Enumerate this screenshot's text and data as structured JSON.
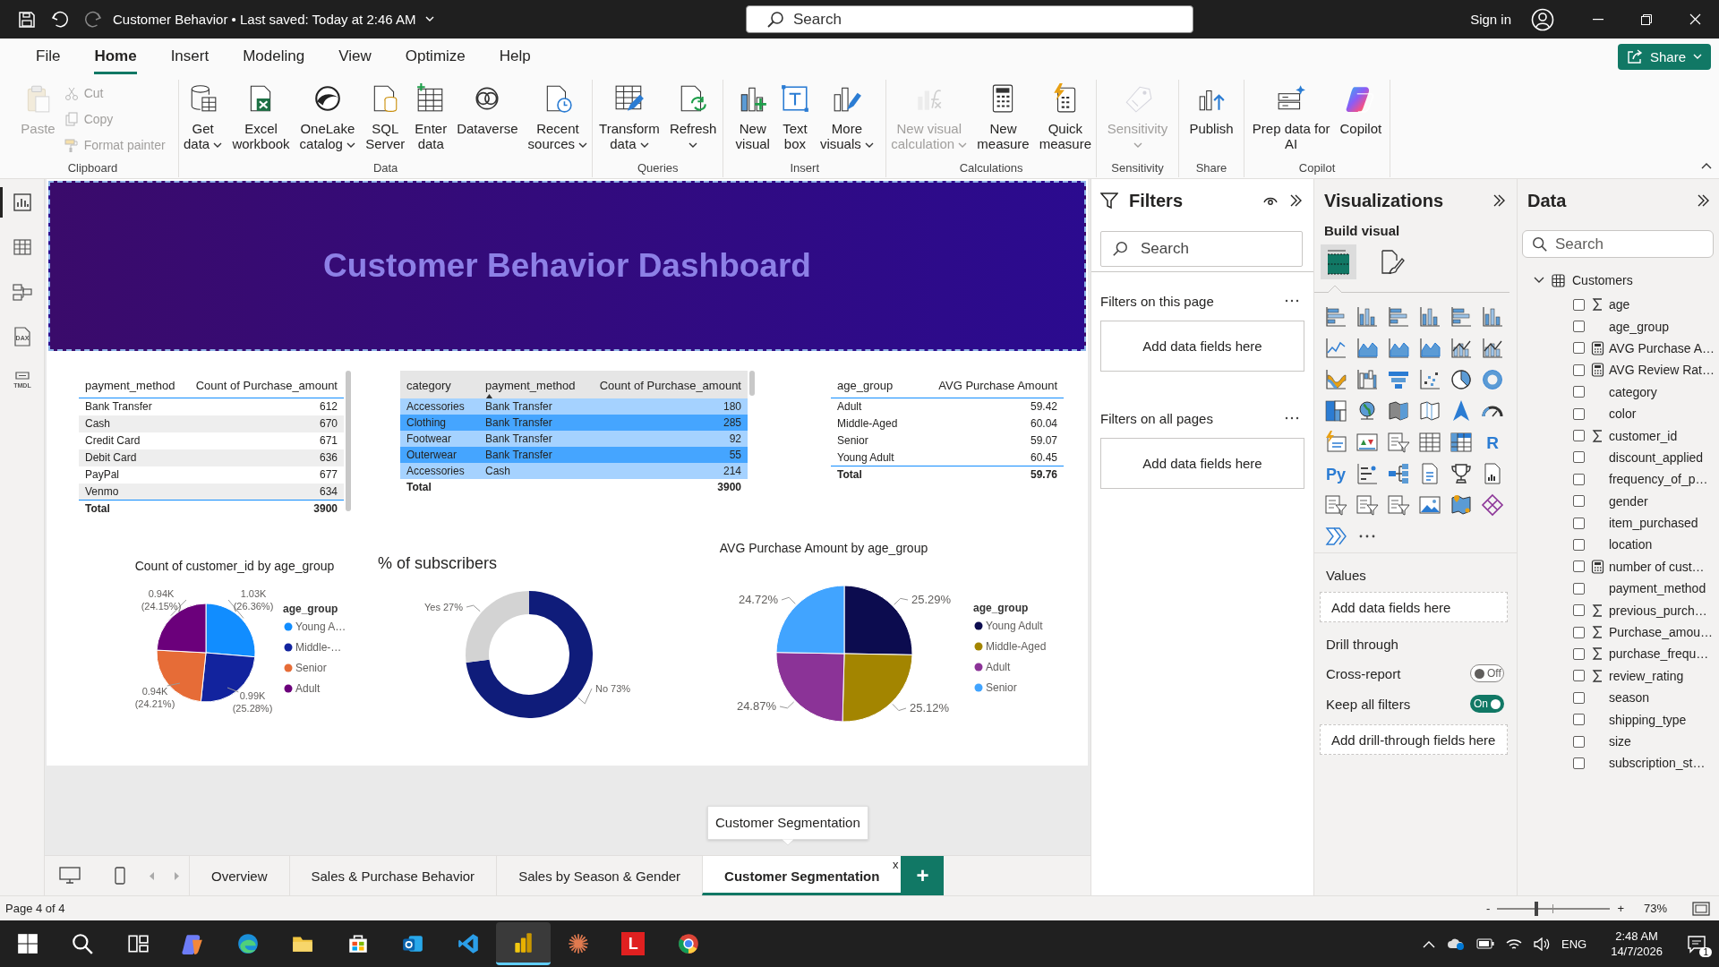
{
  "title_bar": {
    "title": "Customer Behavior • Last saved: Today at 2:46 AM",
    "search_placeholder": "Search",
    "sign_in": "Sign in"
  },
  "menu_tabs": [
    {
      "label": "File",
      "selected": false
    },
    {
      "label": "Home",
      "selected": true
    },
    {
      "label": "Insert",
      "selected": false
    },
    {
      "label": "Modeling",
      "selected": false
    },
    {
      "label": "View",
      "selected": false
    },
    {
      "label": "Optimize",
      "selected": false
    },
    {
      "label": "Help",
      "selected": false
    }
  ],
  "share_button": "Share",
  "ribbon_groups": [
    {
      "label": "Clipboard",
      "buttons": [
        {
          "kind": "large",
          "lines": [
            "Paste"
          ],
          "disabled": true
        },
        {
          "kind": "small",
          "lines": [
            "Cut"
          ],
          "disabled": true
        },
        {
          "kind": "small",
          "lines": [
            "Copy"
          ],
          "disabled": true
        },
        {
          "kind": "small",
          "lines": [
            "Format painter"
          ],
          "disabled": true
        }
      ]
    },
    {
      "label": "Data",
      "buttons": [
        {
          "kind": "large",
          "lines": [
            "Get",
            "data"
          ],
          "dropdown": true,
          "disabled": false
        },
        {
          "kind": "large",
          "lines": [
            "Excel",
            "workbook"
          ],
          "disabled": false
        },
        {
          "kind": "large",
          "lines": [
            "OneLake",
            "catalog"
          ],
          "dropdown": true,
          "disabled": false
        },
        {
          "kind": "large",
          "lines": [
            "SQL",
            "Server"
          ],
          "disabled": false
        },
        {
          "kind": "large",
          "lines": [
            "Enter",
            "data"
          ],
          "disabled": false
        },
        {
          "kind": "large",
          "lines": [
            "Dataverse"
          ],
          "disabled": false
        },
        {
          "kind": "large",
          "lines": [
            "Recent",
            "sources"
          ],
          "dropdown": true,
          "disabled": false
        }
      ]
    },
    {
      "label": "Queries",
      "buttons": [
        {
          "kind": "large",
          "lines": [
            "Transform",
            "data"
          ],
          "dropdown": true,
          "disabled": false
        },
        {
          "kind": "large",
          "lines": [
            "Refresh"
          ],
          "dropdown": true,
          "disabled": false
        }
      ]
    },
    {
      "label": "Insert",
      "buttons": [
        {
          "kind": "large",
          "lines": [
            "New",
            "visual"
          ],
          "disabled": false
        },
        {
          "kind": "large",
          "lines": [
            "Text",
            "box"
          ],
          "disabled": false
        },
        {
          "kind": "large",
          "lines": [
            "More",
            "visuals"
          ],
          "dropdown": true,
          "disabled": false
        }
      ]
    },
    {
      "label": "Calculations",
      "buttons": [
        {
          "kind": "large",
          "lines": [
            "New visual",
            "calculation"
          ],
          "dropdown": true,
          "disabled": true
        },
        {
          "kind": "large",
          "lines": [
            "New",
            "measure"
          ],
          "disabled": false
        },
        {
          "kind": "large",
          "lines": [
            "Quick",
            "measure"
          ],
          "disabled": false
        }
      ]
    },
    {
      "label": "Sensitivity",
      "buttons": [
        {
          "kind": "large",
          "lines": [
            "Sensitivity"
          ],
          "dropdown": true,
          "disabled": true
        }
      ]
    },
    {
      "label": "Share",
      "buttons": [
        {
          "kind": "large",
          "lines": [
            "Publish"
          ],
          "disabled": false
        }
      ]
    },
    {
      "label": "Copilot",
      "buttons": [
        {
          "kind": "large",
          "lines": [
            "Prep data for",
            "AI"
          ],
          "disabled": false
        },
        {
          "kind": "large",
          "lines": [
            "Copilot"
          ],
          "disabled": false
        }
      ]
    }
  ],
  "left_rail": [
    {
      "kind": "report",
      "selected": true
    },
    {
      "kind": "table",
      "selected": false
    },
    {
      "kind": "model",
      "selected": false
    },
    {
      "kind": "dax",
      "label": "DAX",
      "selected": false
    },
    {
      "kind": "tmdl",
      "label": "TMDL",
      "selected": false
    }
  ],
  "report": {
    "banner": {
      "title": "Customer Behavior Dashboard"
    },
    "tables": [
      {
        "kind": "gray-bands",
        "columns": [
          {
            "label": "payment_method",
            "sorted": false
          },
          {
            "label": "Count of Purchase_amount",
            "sorted": false
          }
        ],
        "rows": [
          [
            "Bank Transfer",
            "612"
          ],
          [
            "Cash",
            "670"
          ],
          [
            "Credit Card",
            "671"
          ],
          [
            "Debit Card",
            "636"
          ],
          [
            "PayPal",
            "677"
          ],
          [
            "Venmo",
            "634"
          ]
        ],
        "total": {
          "label": "Total",
          "value": "3900"
        }
      },
      {
        "kind": "blue-bands",
        "columns": [
          {
            "label": "category",
            "sorted": false
          },
          {
            "label": "payment_method",
            "sorted": true
          },
          {
            "label": "Count of Purchase_amount",
            "sorted": false
          }
        ],
        "rows": [
          [
            "Accessories",
            "Bank Transfer",
            "180"
          ],
          [
            "Clothing",
            "Bank Transfer",
            "285"
          ],
          [
            "Footwear",
            "Bank Transfer",
            "92"
          ],
          [
            "Outerwear",
            "Bank Transfer",
            "55"
          ],
          [
            "Accessories",
            "Cash",
            "214"
          ]
        ],
        "total": {
          "label": "Total",
          "value": "3900"
        }
      },
      {
        "kind": "plain",
        "columns": [
          {
            "label": "age_group",
            "sorted": false
          },
          {
            "label": "AVG Purchase Amount",
            "sorted": false
          }
        ],
        "rows": [
          [
            "Adult",
            "59.42"
          ],
          [
            "Middle-Aged",
            "60.04"
          ],
          [
            "Senior",
            "59.07"
          ],
          [
            "Young Adult",
            "60.45"
          ]
        ],
        "total": {
          "label": "Total",
          "value": "59.76"
        }
      }
    ],
    "visuals": [
      {
        "slices": [
          {
            "color": "#118dff"
          },
          {
            "color": "#12239e"
          },
          {
            "color": "#e66c37"
          },
          {
            "color": "#6b007b"
          }
        ],
        "chart_data": {
          "type": "pie",
          "title": "Count of customer_id by age_group",
          "categories": [
            "Young A…",
            "Middle-…",
            "Senior",
            "Adult"
          ],
          "values": [
            26.36,
            25.28,
            24.21,
            24.15
          ],
          "value_labels": [
            "1.03K (26.36%)",
            "0.99K (25.28%)",
            "0.94K (24.21%)",
            "0.94K (24.15%)"
          ],
          "legend": {
            "title": "age_group"
          }
        }
      },
      {
        "slices": [
          {
            "color": "#0f1c7a"
          },
          {
            "color": "#d3d3d3"
          }
        ],
        "chart_data": {
          "type": "donut",
          "title": "% of subscribers",
          "values": [
            73,
            27
          ],
          "value_labels": [
            "No 73%",
            "Yes 27%"
          ]
        }
      },
      {
        "slices": [
          {
            "color": "#0c0c4f"
          },
          {
            "color": "#a38500"
          },
          {
            "color": "#8b3397"
          },
          {
            "color": "#41a4ff"
          }
        ],
        "chart_data": {
          "type": "pie",
          "title": "AVG Purchase Amount by age_group",
          "categories": [
            "Young Adult",
            "Middle-Aged",
            "Adult",
            "Senior"
          ],
          "values": [
            25.29,
            25.12,
            24.87,
            24.72
          ],
          "value_labels": [
            "25.29%",
            "25.12%",
            "24.87%",
            "24.72%"
          ],
          "legend": {
            "title": "age_group"
          }
        }
      }
    ]
  },
  "filters_pane": {
    "title": "Filters",
    "search_placeholder": "Search",
    "sections": [
      {
        "label": "Filters on this page",
        "drop_zone": "Add data fields here"
      },
      {
        "label": "Filters on all pages",
        "drop_zone": "Add data fields here"
      }
    ]
  },
  "visualizations_pane": {
    "title": "Visualizations",
    "subtitle": "Build visual",
    "build_tabs": [
      {
        "kind": "fields",
        "selected": true
      },
      {
        "kind": "format",
        "selected": false
      }
    ],
    "gallery": [
      {
        "kind": "hbar"
      },
      {
        "kind": "vbar"
      },
      {
        "kind": "hbar"
      },
      {
        "kind": "vbar"
      },
      {
        "kind": "hbar"
      },
      {
        "kind": "vbar"
      },
      {
        "kind": "line"
      },
      {
        "kind": "area"
      },
      {
        "kind": "area"
      },
      {
        "kind": "area"
      },
      {
        "kind": "combo"
      },
      {
        "kind": "combo"
      },
      {
        "kind": "ribbon"
      },
      {
        "kind": "waterfall"
      },
      {
        "kind": "funnel"
      },
      {
        "kind": "scatter"
      },
      {
        "kind": "pie"
      },
      {
        "kind": "donut"
      },
      {
        "kind": "treemap"
      },
      {
        "kind": "globe"
      },
      {
        "kind": "map"
      },
      {
        "kind": "map-outline"
      },
      {
        "kind": "arrow"
      },
      {
        "kind": "gauge"
      },
      {
        "kind": "card"
      },
      {
        "kind": "kpi"
      },
      {
        "kind": "slicer"
      },
      {
        "kind": "table"
      },
      {
        "kind": "matrix"
      },
      {
        "kind": "letter",
        "label": "R"
      },
      {
        "kind": "letter",
        "label": "Py"
      },
      {
        "kind": "influencers"
      },
      {
        "kind": "tree"
      },
      {
        "kind": "doc"
      },
      {
        "kind": "trophy"
      },
      {
        "kind": "report"
      },
      {
        "kind": "slicer"
      },
      {
        "kind": "slicer"
      },
      {
        "kind": "slicer"
      },
      {
        "kind": "image"
      },
      {
        "kind": "pin"
      },
      {
        "kind": "diamond"
      },
      {
        "kind": "chevrons"
      },
      {
        "kind": "more"
      }
    ],
    "values_label": "Values",
    "values_drop_zone": "Add data fields here",
    "drill_through_label": "Drill through",
    "toggles": [
      {
        "label": "Cross-report",
        "on": false,
        "state_text": "Off"
      },
      {
        "label": "Keep all filters",
        "on": true,
        "state_text": "On"
      }
    ],
    "drill_drop_zone": "Add drill-through fields here"
  },
  "data_pane": {
    "title": "Data",
    "search_placeholder": "Search",
    "tables": [
      {
        "name": "Customers",
        "expanded": true,
        "children": [
          {
            "label": "age",
            "kind": "sum",
            "checked": false
          },
          {
            "label": "age_group",
            "kind": "plain",
            "checked": false
          },
          {
            "label": "AVG Purchase A…",
            "kind": "measure",
            "checked": false
          },
          {
            "label": "AVG Review Rat…",
            "kind": "measure",
            "checked": false
          },
          {
            "label": "category",
            "kind": "plain",
            "checked": false
          },
          {
            "label": "color",
            "kind": "plain",
            "checked": false
          },
          {
            "label": "customer_id",
            "kind": "sum",
            "checked": false
          },
          {
            "label": "discount_applied",
            "kind": "plain",
            "checked": false
          },
          {
            "label": "frequency_of_p…",
            "kind": "plain",
            "checked": false
          },
          {
            "label": "gender",
            "kind": "plain",
            "checked": false
          },
          {
            "label": "item_purchased",
            "kind": "plain",
            "checked": false
          },
          {
            "label": "location",
            "kind": "plain",
            "checked": false
          },
          {
            "label": "number of cust…",
            "kind": "measure",
            "checked": false
          },
          {
            "label": "payment_method",
            "kind": "plain",
            "checked": false
          },
          {
            "label": "previous_purch…",
            "kind": "sum",
            "checked": false
          },
          {
            "label": "Purchase_amou…",
            "kind": "sum",
            "checked": false
          },
          {
            "label": "purchase_frequ…",
            "kind": "sum",
            "checked": false
          },
          {
            "label": "review_rating",
            "kind": "sum",
            "checked": false
          },
          {
            "label": "season",
            "kind": "plain",
            "checked": false
          },
          {
            "label": "shipping_type",
            "kind": "plain",
            "checked": false
          },
          {
            "label": "size",
            "kind": "plain",
            "checked": false
          },
          {
            "label": "subscription_st…",
            "kind": "plain",
            "checked": false
          }
        ]
      }
    ]
  },
  "page_tabs": {
    "tabs": [
      {
        "label": "Overview",
        "selected": false
      },
      {
        "label": "Sales & Purchase Behavior",
        "selected": false
      },
      {
        "label": "Sales by Season & Gender",
        "selected": false
      },
      {
        "label": "Customer Segmentation",
        "selected": true
      }
    ],
    "close_glyph": "x",
    "add_glyph": "+",
    "tooltip": "Customer Segmentation"
  },
  "status_bar": {
    "page": "Page 4 of 4",
    "zoom_out": "-",
    "zoom_in": "+",
    "zoom": {
      "level": 0.35
    },
    "zoom_text": "73%"
  },
  "taskbar": {
    "apps": [
      {
        "kind": "start",
        "active": false
      },
      {
        "kind": "search",
        "active": false
      },
      {
        "kind": "taskview",
        "active": false
      },
      {
        "kind": "copilot",
        "active": false
      },
      {
        "kind": "edge",
        "active": false
      },
      {
        "kind": "folder",
        "active": false
      },
      {
        "kind": "store",
        "active": false
      },
      {
        "kind": "mail",
        "active": false
      },
      {
        "kind": "code",
        "active": false
      },
      {
        "kind": "powerbi",
        "active": true
      },
      {
        "kind": "star",
        "active": false
      },
      {
        "kind": "letter",
        "label": "L",
        "active": false
      },
      {
        "kind": "chrome",
        "active": false
      }
    ],
    "language": "ENG",
    "time": "2:48 AM",
    "date": "14/7/2026",
    "notifications": "1"
  }
}
